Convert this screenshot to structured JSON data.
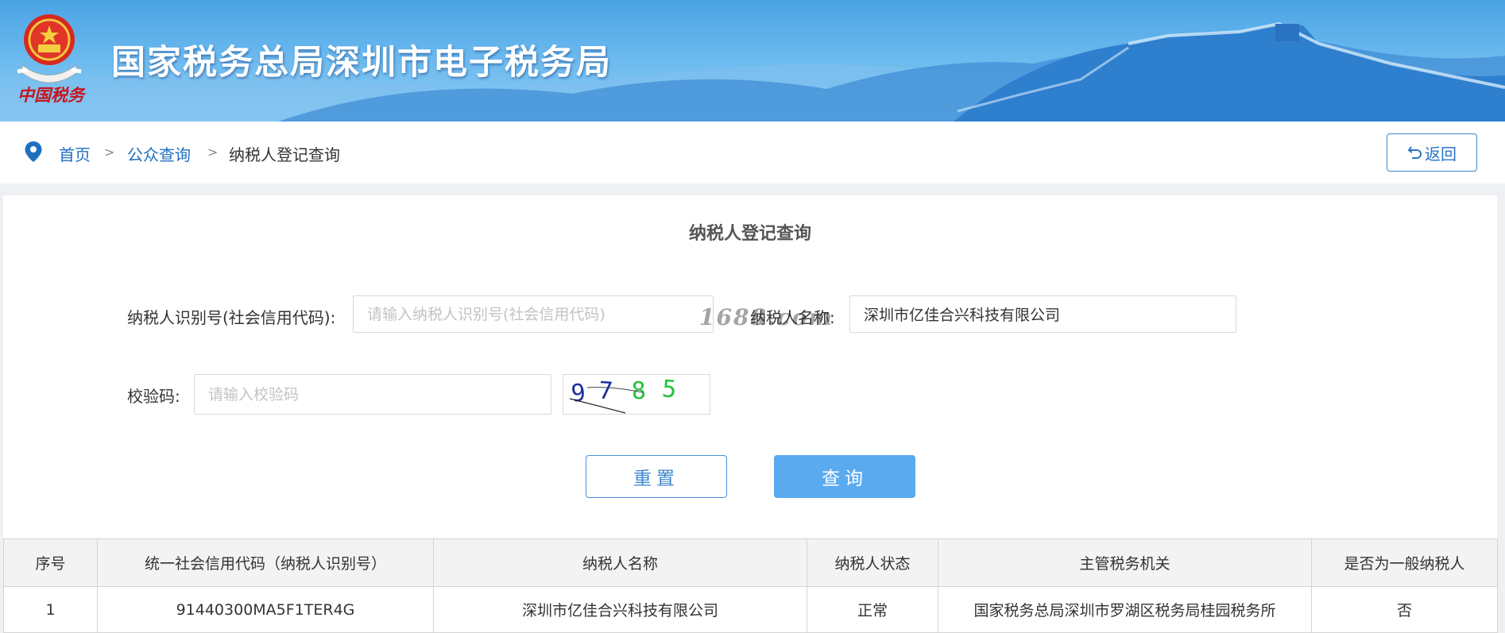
{
  "header": {
    "title": "国家税务总局深圳市电子税务局",
    "emblem_caption": "中国税务",
    "colors": {
      "banner_top": "#4ba3e4",
      "banner_bottom": "#8fcdf3",
      "mountains": "#2f7fcf"
    }
  },
  "breadcrumb": {
    "items": [
      "首页",
      "公众查询",
      "纳税人登记查询"
    ],
    "separator": ">",
    "back_label": "返回"
  },
  "form": {
    "heading": "纳税人登记查询",
    "taxpayer_id_label": "纳税人识别号(社会信用代码):",
    "taxpayer_id_placeholder": "请输入纳税人识别号(社会信用代码)",
    "taxpayer_id_value": "",
    "watermark": "1688.com",
    "taxpayer_name_label": "纳税人名称:",
    "taxpayer_name_value": "深圳市亿佳合兴科技有限公司",
    "captcha_label": "校验码:",
    "captcha_placeholder": "请输入校验码",
    "captcha_value": "",
    "captcha_digits": [
      "9",
      "7",
      "8",
      "5"
    ],
    "reset_label": "重置",
    "query_label": "查询",
    "colors": {
      "accent": "#5aaaf0",
      "link": "#1f6fc1"
    }
  },
  "table": {
    "headers": [
      "序号",
      "统一社会信用代码（纳税人识别号）",
      "纳税人名称",
      "纳税人状态",
      "主管税务机关",
      "是否为一般纳税人"
    ],
    "rows": [
      [
        "1",
        "91440300MA5F1TER4G",
        "深圳市亿佳合兴科技有限公司",
        "正常",
        "国家税务总局深圳市罗湖区税务局桂园税务所",
        "否"
      ]
    ]
  }
}
